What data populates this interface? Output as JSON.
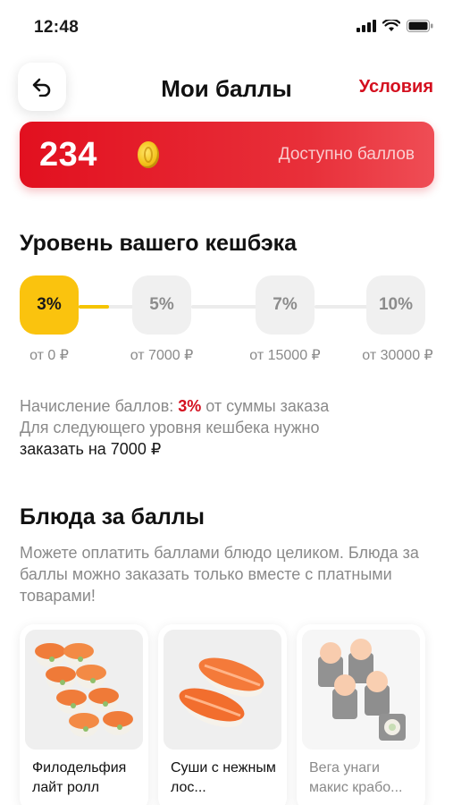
{
  "status": {
    "time": "12:48"
  },
  "header": {
    "title": "Мои баллы",
    "terms": "Условия"
  },
  "balance": {
    "value": "234",
    "caption": "Доступно баллов"
  },
  "cashback": {
    "title": "Уровень вашего кешбэка",
    "levels": [
      {
        "percent": "3%",
        "threshold": "от 0 ₽",
        "active": true
      },
      {
        "percent": "5%",
        "threshold": "от 7000 ₽",
        "active": false
      },
      {
        "percent": "7%",
        "threshold": "от 15000 ₽",
        "active": false
      },
      {
        "percent": "10%",
        "threshold": "от 30000 ₽",
        "active": false
      }
    ],
    "progress_to_next": 0.55,
    "info_prefix": "Начисление баллов: ",
    "info_percent": "3%",
    "info_suffix": " от суммы заказа",
    "next_level_line": "Для следующего уровня кешбека нужно",
    "next_level_amount": "заказать на 7000 ₽"
  },
  "dishes": {
    "title": "Блюда за баллы",
    "description": "Можете оплатить баллами блюдо целиком. Блюда за баллы можно заказать только вместе с платными товарами!",
    "items": [
      {
        "name": "Филодельфия лайт ролл",
        "available": true
      },
      {
        "name": "Суши с нежным лос...",
        "available": true
      },
      {
        "name": "Вега унаги макис крабо...",
        "available": false
      }
    ]
  },
  "colors": {
    "accent_red": "#e2101f",
    "level_active": "#fac30e"
  }
}
